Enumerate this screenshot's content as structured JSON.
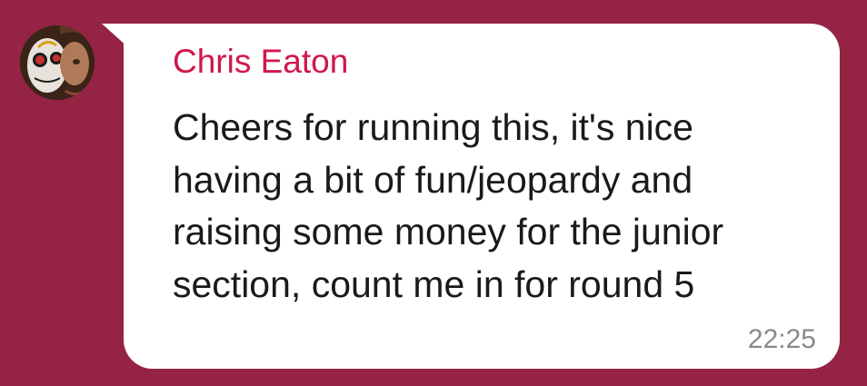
{
  "message": {
    "sender_name": "Chris Eaton",
    "text_lines": [
      "Cheers for running this, it's nice",
      "having a bit of fun/jeopardy and",
      "raising some money for the junior",
      "section, count me in for round 5"
    ],
    "timestamp": "22:25"
  },
  "colors": {
    "background": "#952344",
    "bubble": "#ffffff",
    "sender_name": "#d0174a",
    "message_text": "#1a1a1a",
    "timestamp": "#8a8a8a"
  },
  "icons": {
    "avatar": "user-avatar-face-paint"
  }
}
